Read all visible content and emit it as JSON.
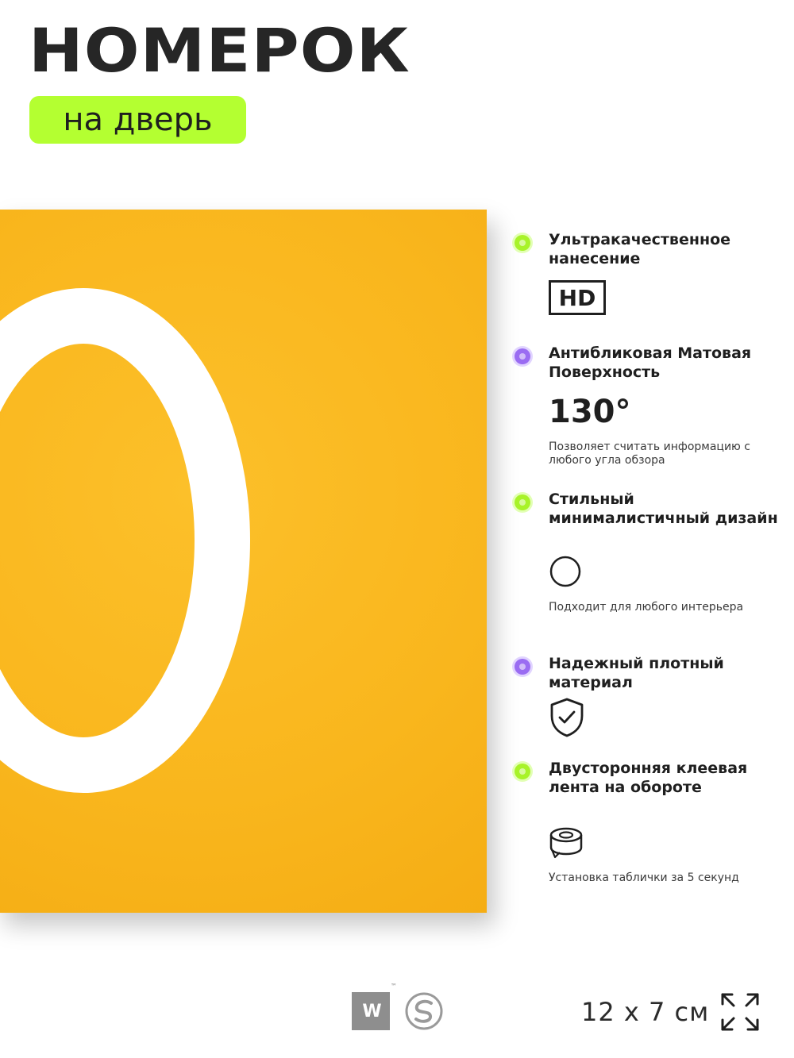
{
  "header": {
    "title": "НОМЕРОК",
    "subtitle": "на дверь"
  },
  "product": {
    "digit": "0",
    "plate_color": "#f9b61d",
    "digit_color": "#ffffff"
  },
  "features": [
    {
      "bullet": "green",
      "title": "Ультракачественное нанесение",
      "badge": "HD"
    },
    {
      "bullet": "purple",
      "title": "Антибликовая Матовая Поверхность",
      "value": "130°",
      "note": "Позволяет считать информацию с любого угла обзора"
    },
    {
      "bullet": "green",
      "title": "Стильный минималистичный дизайн",
      "icon": "circle-icon",
      "note": "Подходит для любого интерьера"
    },
    {
      "bullet": "purple",
      "title": "Надежный плотный материал",
      "icon": "shield-check-icon"
    },
    {
      "bullet": "green",
      "title": "Двусторонняя клеевая лента на обороте",
      "icon": "tape-roll-icon",
      "note": "Установка таблички за 5 секунд"
    }
  ],
  "footer": {
    "logo_text": "W",
    "trademark": "™",
    "size": "12 x 7 см"
  },
  "colors": {
    "accent_green": "#b4ff31",
    "accent_purple": "#9a6cf2",
    "text": "#1f1f1f"
  }
}
